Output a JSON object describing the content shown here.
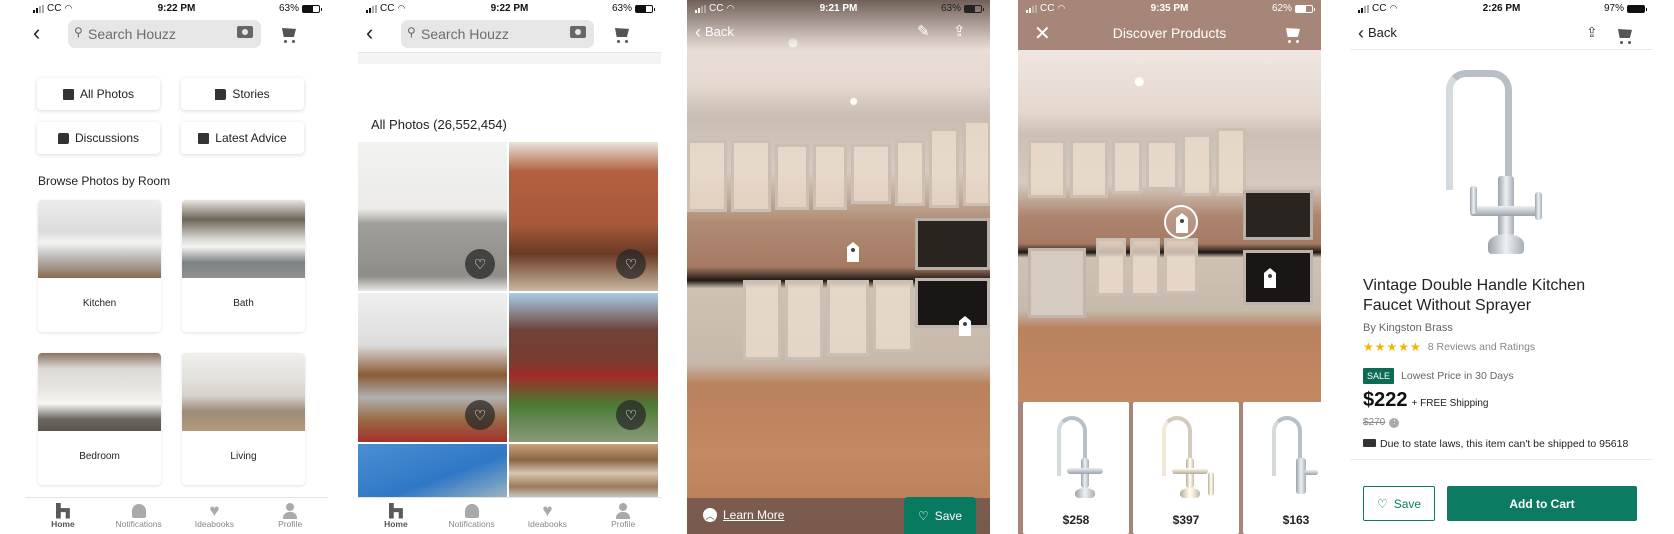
{
  "colors": {
    "brand_green": "#0d7a62",
    "star": "#f5b400",
    "photo_overlay": "#a68679"
  },
  "screens": [
    {
      "status": {
        "carrier": "CC",
        "time": "9:22 PM",
        "battery": "63%",
        "battery_level": 0.63
      },
      "search": {
        "placeholder": "Search Houzz"
      },
      "quick_links": [
        {
          "label": "All Photos",
          "icon": "photos-icon"
        },
        {
          "label": "Stories",
          "icon": "book-icon"
        },
        {
          "label": "Discussions",
          "icon": "chat-icon"
        },
        {
          "label": "Latest Advice",
          "icon": "advice-icon"
        }
      ],
      "section_title": "Browse Photos by Room",
      "rooms": [
        {
          "label": "Kitchen"
        },
        {
          "label": "Bath"
        },
        {
          "label": "Bedroom"
        },
        {
          "label": "Living"
        }
      ]
    },
    {
      "status": {
        "carrier": "CC",
        "time": "9:22 PM",
        "battery": "63%",
        "battery_level": 0.63
      },
      "search": {
        "placeholder": "Search Houzz"
      },
      "grid_title": "All Photos (26,552,454)",
      "photos": [
        {
          "subject": "bathroom vanity"
        },
        {
          "subject": "dining room brick wall"
        },
        {
          "subject": "modern kitchen"
        },
        {
          "subject": "brick house exterior"
        },
        {
          "subject": "modern exterior"
        },
        {
          "subject": "rustic interior lanterns"
        }
      ]
    },
    {
      "status": {
        "carrier": "CC",
        "time": "9:21 PM",
        "battery": "63%",
        "battery_level": 0.63
      },
      "back_label": "Back",
      "learn_more": "Learn More",
      "save_label": "Save"
    },
    {
      "status": {
        "carrier": "CC",
        "time": "9:35 PM",
        "battery": "62%",
        "battery_level": 0.62
      },
      "title": "Discover Products",
      "products": [
        {
          "price": "$258"
        },
        {
          "price": "$397"
        },
        {
          "price": "$163"
        }
      ]
    },
    {
      "status": {
        "carrier": "CC",
        "time": "2:26 PM",
        "battery": "97%",
        "battery_level": 0.97
      },
      "back_label": "Back",
      "product": {
        "title": "Vintage Double Handle Kitchen Faucet Without Sprayer",
        "brand": "By Kingston Brass",
        "rating": 5,
        "stars": "★★★★★",
        "reviews": "8 Reviews and Ratings",
        "sale_badge": "SALE",
        "sale_text": "Lowest Price in 30 Days",
        "price": "$222",
        "shipping": "+ FREE Shipping",
        "old_price": "$270",
        "ship_note": "Due to state laws, this item can't be shipped to 95618"
      },
      "save_label": "Save",
      "add_to_cart_label": "Add to Cart"
    }
  ],
  "tabbar": [
    {
      "label": "Home",
      "active": true
    },
    {
      "label": "Notifications"
    },
    {
      "label": "Ideabooks"
    },
    {
      "label": "Profile"
    }
  ]
}
